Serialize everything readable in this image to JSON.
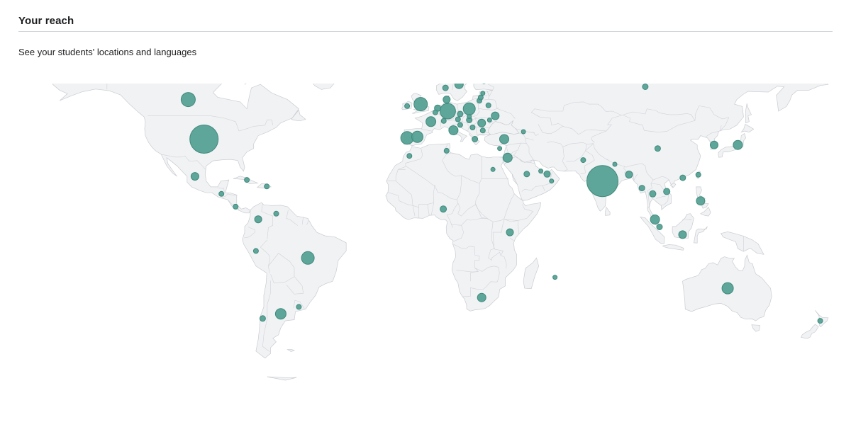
{
  "section": {
    "title": "Your reach",
    "subtitle": "See your students' locations and languages"
  },
  "map": {
    "type": "bubble-map",
    "projection": "equirectangular",
    "bubble_color": "#529f91",
    "land_color": "#f1f2f4",
    "border_color": "#c9ccd1",
    "locations": [
      {
        "name": "united-states",
        "lat": 39,
        "lon": -98,
        "r": 20
      },
      {
        "name": "canada",
        "lat": 56,
        "lon": -105,
        "r": 10
      },
      {
        "name": "mexico",
        "lat": 23,
        "lon": -102,
        "r": 5.5
      },
      {
        "name": "guatemala",
        "lat": 15.5,
        "lon": -90.3,
        "r": 3.5
      },
      {
        "name": "costa-rica",
        "lat": 10,
        "lon": -84,
        "r": 3.5
      },
      {
        "name": "cuba",
        "lat": 21.5,
        "lon": -79,
        "r": 3.5
      },
      {
        "name": "dominican-republic",
        "lat": 18.7,
        "lon": -70.2,
        "r": 3.5
      },
      {
        "name": "colombia",
        "lat": 4.6,
        "lon": -74,
        "r": 5
      },
      {
        "name": "venezuela",
        "lat": 7,
        "lon": -66,
        "r": 3.5
      },
      {
        "name": "peru",
        "lat": -9,
        "lon": -75,
        "r": 3.5
      },
      {
        "name": "brazil",
        "lat": -12,
        "lon": -52,
        "r": 9
      },
      {
        "name": "argentina",
        "lat": -36,
        "lon": -64,
        "r": 7.5
      },
      {
        "name": "chile",
        "lat": -38,
        "lon": -72,
        "r": 4
      },
      {
        "name": "uruguay",
        "lat": -33,
        "lon": -56,
        "r": 3.5
      },
      {
        "name": "iceland",
        "lat": 65,
        "lon": -18,
        "r": 3.5
      },
      {
        "name": "ireland",
        "lat": 53.2,
        "lon": -8,
        "r": 3.5
      },
      {
        "name": "united-kingdom",
        "lat": 54,
        "lon": -2,
        "r": 9.5
      },
      {
        "name": "portugal",
        "lat": 39.5,
        "lon": -8,
        "r": 9
      },
      {
        "name": "spain",
        "lat": 40,
        "lon": -3.5,
        "r": 8
      },
      {
        "name": "france",
        "lat": 46.5,
        "lon": 2.5,
        "r": 7
      },
      {
        "name": "belgium",
        "lat": 50.5,
        "lon": 4.5,
        "r": 3.5
      },
      {
        "name": "netherlands",
        "lat": 52.3,
        "lon": 5.5,
        "r": 4.5
      },
      {
        "name": "switzerland",
        "lat": 46.8,
        "lon": 8.2,
        "r": 3.5
      },
      {
        "name": "italy",
        "lat": 42.8,
        "lon": 12.5,
        "r": 6.5
      },
      {
        "name": "germany",
        "lat": 51,
        "lon": 10,
        "r": 11
      },
      {
        "name": "denmark",
        "lat": 56,
        "lon": 9.5,
        "r": 5
      },
      {
        "name": "norway",
        "lat": 61,
        "lon": 9,
        "r": 4
      },
      {
        "name": "sweden",
        "lat": 62.5,
        "lon": 15,
        "r": 6
      },
      {
        "name": "finland",
        "lat": 64,
        "lon": 26,
        "r": 4
      },
      {
        "name": "poland",
        "lat": 52,
        "lon": 19.5,
        "r": 8.5
      },
      {
        "name": "czechia",
        "lat": 49.8,
        "lon": 15.5,
        "r": 4
      },
      {
        "name": "austria",
        "lat": 47.5,
        "lon": 14.5,
        "r": 3.5
      },
      {
        "name": "slovakia",
        "lat": 48.7,
        "lon": 19.5,
        "r": 3
      },
      {
        "name": "hungary",
        "lat": 47.2,
        "lon": 19.5,
        "r": 4
      },
      {
        "name": "croatia",
        "lat": 45.1,
        "lon": 15.5,
        "r": 3.5
      },
      {
        "name": "serbia",
        "lat": 44,
        "lon": 21,
        "r": 3.5
      },
      {
        "name": "romania",
        "lat": 45.9,
        "lon": 25,
        "r": 5.5
      },
      {
        "name": "bulgaria",
        "lat": 42.7,
        "lon": 25.5,
        "r": 3.5
      },
      {
        "name": "greece",
        "lat": 39,
        "lon": 22,
        "r": 4
      },
      {
        "name": "lithuania",
        "lat": 55.5,
        "lon": 24,
        "r": 3.5
      },
      {
        "name": "latvia",
        "lat": 56.9,
        "lon": 24.6,
        "r": 3.5
      },
      {
        "name": "estonia",
        "lat": 58.7,
        "lon": 25.5,
        "r": 3
      },
      {
        "name": "belarus",
        "lat": 53.5,
        "lon": 28,
        "r": 3.5
      },
      {
        "name": "ukraine",
        "lat": 49,
        "lon": 31,
        "r": 5.5
      },
      {
        "name": "moldova",
        "lat": 47.2,
        "lon": 28.5,
        "r": 3
      },
      {
        "name": "russia",
        "lat": 61.5,
        "lon": 97.5,
        "r": 4
      },
      {
        "name": "turkey",
        "lat": 39,
        "lon": 35,
        "r": 6.5
      },
      {
        "name": "georgia",
        "lat": 42.2,
        "lon": 43.5,
        "r": 3
      },
      {
        "name": "cyprus",
        "lat": 35,
        "lon": 33,
        "r": 3
      },
      {
        "name": "tunisia",
        "lat": 34,
        "lon": 9.5,
        "r": 3.5
      },
      {
        "name": "morocco",
        "lat": 31.8,
        "lon": -7,
        "r": 3.5
      },
      {
        "name": "egypt",
        "lat": 26,
        "lon": 30,
        "r": 3
      },
      {
        "name": "jordan",
        "lat": 31,
        "lon": 36.5,
        "r": 6.5
      },
      {
        "name": "saudi-arabia",
        "lat": 24,
        "lon": 45,
        "r": 4
      },
      {
        "name": "qatar",
        "lat": 25.3,
        "lon": 51.2,
        "r": 3
      },
      {
        "name": "uae",
        "lat": 24,
        "lon": 54,
        "r": 4.5
      },
      {
        "name": "oman",
        "lat": 21,
        "lon": 56,
        "r": 3
      },
      {
        "name": "pakistan",
        "lat": 30,
        "lon": 70,
        "r": 3.5
      },
      {
        "name": "nepal",
        "lat": 28.2,
        "lon": 84,
        "r": 3
      },
      {
        "name": "india",
        "lat": 21,
        "lon": 78.5,
        "r": 22
      },
      {
        "name": "bangladesh",
        "lat": 23.8,
        "lon": 90.3,
        "r": 5
      },
      {
        "name": "myanmar",
        "lat": 18,
        "lon": 96,
        "r": 4
      },
      {
        "name": "thailand",
        "lat": 15.5,
        "lon": 100.8,
        "r": 4.5
      },
      {
        "name": "vietnam",
        "lat": 16.5,
        "lon": 107,
        "r": 4.5
      },
      {
        "name": "malaysia",
        "lat": 4.5,
        "lon": 101.8,
        "r": 6.5
      },
      {
        "name": "singapore",
        "lat": 1.3,
        "lon": 103.8,
        "r": 4
      },
      {
        "name": "indonesia",
        "lat": -2,
        "lon": 114,
        "r": 5.5
      },
      {
        "name": "philippines",
        "lat": 12.5,
        "lon": 122,
        "r": 6
      },
      {
        "name": "hong-kong",
        "lat": 22.4,
        "lon": 114.1,
        "r": 4
      },
      {
        "name": "taiwan",
        "lat": 23.7,
        "lon": 121,
        "r": 3.5
      },
      {
        "name": "china",
        "lat": 35,
        "lon": 103,
        "r": 4
      },
      {
        "name": "south-korea",
        "lat": 36.5,
        "lon": 128,
        "r": 5.5
      },
      {
        "name": "japan",
        "lat": 36.5,
        "lon": 138.5,
        "r": 6.5
      },
      {
        "name": "nigeria",
        "lat": 9,
        "lon": 8,
        "r": 4.5
      },
      {
        "name": "kenya",
        "lat": -1,
        "lon": 37.5,
        "r": 5
      },
      {
        "name": "mauritius",
        "lat": -20.3,
        "lon": 57.5,
        "r": 3
      },
      {
        "name": "south-africa",
        "lat": -29,
        "lon": 25,
        "r": 6
      },
      {
        "name": "australia",
        "lat": -25,
        "lon": 134,
        "r": 8
      },
      {
        "name": "new-zealand",
        "lat": -39,
        "lon": 175,
        "r": 3.5
      }
    ]
  }
}
